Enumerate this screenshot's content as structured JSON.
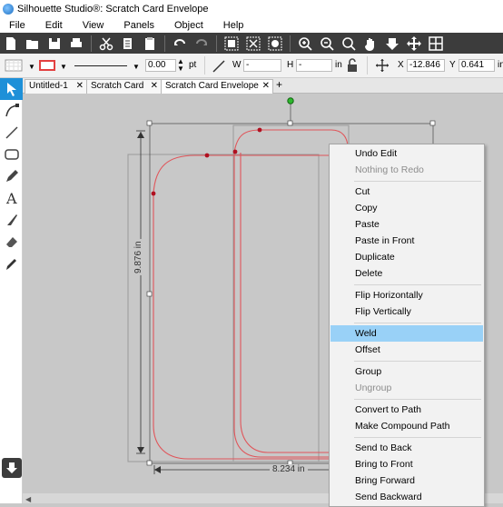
{
  "window": {
    "title": "Silhouette Studio®: Scratch Card Envelope"
  },
  "menu": [
    "File",
    "Edit",
    "View",
    "Panels",
    "Object",
    "Help"
  ],
  "toolbar": {
    "line_width_value": "0.00",
    "line_width_unit": "pt",
    "w_label": "W",
    "w_value": "-",
    "h_label": "H",
    "h_value": "-",
    "dim_unit": "in",
    "x_label": "X",
    "x_value": "-12.846",
    "y_label": "Y",
    "y_value": "0.641",
    "pos_unit": "in"
  },
  "tabs": [
    {
      "label": "Untitled-1",
      "active": false
    },
    {
      "label": "Scratch Card",
      "active": false
    },
    {
      "label": "Scratch Card Envelope",
      "active": true
    }
  ],
  "canvas": {
    "height_dimension": "9.876 in",
    "width_dimension": "8.234 in"
  },
  "context_menu": {
    "items": [
      {
        "label": "Undo Edit",
        "enabled": true
      },
      {
        "label": "Nothing to Redo",
        "enabled": false
      },
      {
        "label": "Cut",
        "enabled": true
      },
      {
        "label": "Copy",
        "enabled": true
      },
      {
        "label": "Paste",
        "enabled": true
      },
      {
        "label": "Paste in Front",
        "enabled": true
      },
      {
        "label": "Duplicate",
        "enabled": true
      },
      {
        "label": "Delete",
        "enabled": true
      },
      {
        "label": "Flip Horizontally",
        "enabled": true
      },
      {
        "label": "Flip Vertically",
        "enabled": true
      },
      {
        "label": "Weld",
        "enabled": true,
        "highlighted": true
      },
      {
        "label": "Offset",
        "enabled": true
      },
      {
        "label": "Group",
        "enabled": true
      },
      {
        "label": "Ungroup",
        "enabled": false
      },
      {
        "label": "Convert to Path",
        "enabled": true
      },
      {
        "label": "Make Compound Path",
        "enabled": true
      },
      {
        "label": "Send to Back",
        "enabled": true
      },
      {
        "label": "Bring to Front",
        "enabled": true
      },
      {
        "label": "Bring Forward",
        "enabled": true
      },
      {
        "label": "Send Backward",
        "enabled": true
      }
    ]
  },
  "colors": {
    "toolbar_dark": "#3c3c3c",
    "selection_highlight": "#99d1f7",
    "cut_line": "#e0555a",
    "node_point": "#b01020",
    "rotate_handle": "#2db82d",
    "active_tool": "#1e90d8"
  }
}
